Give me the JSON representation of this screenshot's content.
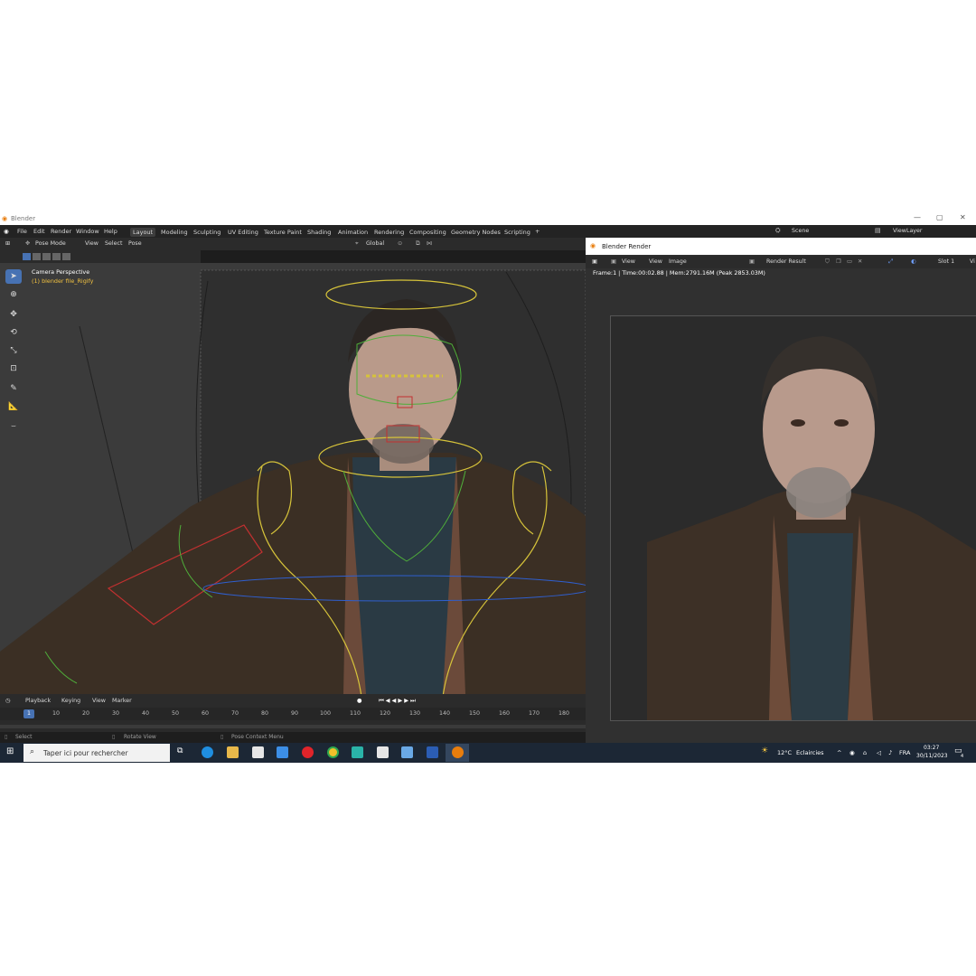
{
  "window": {
    "title": "Blender",
    "min": "—",
    "max": "▢",
    "close": "✕"
  },
  "menu": [
    "File",
    "Edit",
    "Render",
    "Window",
    "Help"
  ],
  "workspaces": [
    "Layout",
    "Modeling",
    "Sculpting",
    "UV Editing",
    "Texture Paint",
    "Shading",
    "Animation",
    "Rendering",
    "Compositing",
    "Geometry Nodes",
    "Scripting"
  ],
  "workspace_add": "+",
  "scene": {
    "name": "Scene",
    "view_layer": "ViewLayer"
  },
  "header": {
    "mode": "Pose Mode",
    "view": "View",
    "select": "Select",
    "pose": "Pose",
    "orientation": "Global"
  },
  "viewport": {
    "camera_label": "Camera Perspective",
    "object_label": "(1) blender file_Rigify"
  },
  "timeline": {
    "playback": "Playback",
    "keying": "Keying",
    "view": "View",
    "marker": "Marker",
    "current_frame": "1",
    "ticks": [
      "10",
      "20",
      "30",
      "40",
      "50",
      "60",
      "70",
      "80",
      "90",
      "100",
      "110",
      "120",
      "130",
      "140",
      "150",
      "160",
      "170",
      "180"
    ]
  },
  "status": {
    "select": "Select",
    "rotate": "Rotate View",
    "context": "Pose Context Menu"
  },
  "render_window": {
    "title": "Blender Render",
    "view": "View",
    "view2": "View",
    "image": "Image",
    "result": "Render Result",
    "slot": "Slot 1",
    "vi": "Vi",
    "info": "Frame:1 | Time:00:02.88 | Mem:2791.16M (Peak 2853.03M)"
  },
  "taskbar": {
    "search_placeholder": "Taper ici pour rechercher",
    "weather_temp": "12°C",
    "weather_text": "Eclaircies",
    "lang": "FRA",
    "time": "03:27",
    "date": "30/11/2023",
    "notif": "4"
  },
  "colors": {
    "accent": "#4772b3",
    "rig_yellow": "#d6c33a",
    "rig_green": "#4fae3a",
    "rig_red": "#c23030",
    "rig_blue": "#2f5fcf"
  }
}
